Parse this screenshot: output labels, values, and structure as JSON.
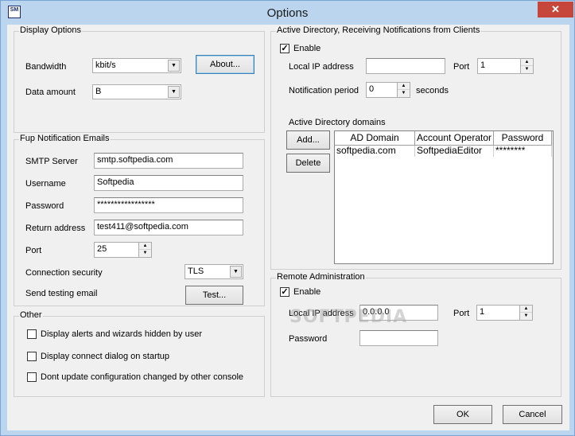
{
  "window": {
    "title": "Options",
    "icon": "app-icon",
    "icon_text": "SM",
    "close_glyph": "✕"
  },
  "display_options": {
    "title": "Display Options",
    "bandwidth_label": "Bandwidth",
    "bandwidth_value": "kbit/s",
    "data_amount_label": "Data amount",
    "data_amount_value": "B",
    "about_button": "About..."
  },
  "fup": {
    "title": "Fup Notification Emails",
    "smtp_label": "SMTP Server",
    "smtp_value": "smtp.softpedia.com",
    "username_label": "Username",
    "username_value": "Softpedia",
    "password_label": "Password",
    "password_value": "*****************",
    "return_label": "Return address",
    "return_value": "test411@softpedia.com",
    "port_label": "Port",
    "port_value": "25",
    "security_label": "Connection security",
    "security_value": "TLS",
    "test_label": "Send testing email",
    "test_button": "Test..."
  },
  "other": {
    "title": "Other",
    "options": [
      {
        "label": "Display alerts and wizards hidden by user",
        "checked": false
      },
      {
        "label": "Display connect dialog on startup",
        "checked": false
      },
      {
        "label": "Dont update configuration changed by other console",
        "checked": false
      }
    ]
  },
  "active_directory": {
    "title": "Active Directory, Receiving Notifications from Clients",
    "enable_label": "Enable",
    "enable_checked": true,
    "local_ip_label": "Local IP address",
    "local_ip_value": "",
    "port_label": "Port",
    "port_value": "1",
    "period_label": "Notification period",
    "period_value": "0",
    "period_unit": "seconds",
    "domains_label": "Active Directory domains",
    "add_button": "Add...",
    "delete_button": "Delete",
    "columns": [
      "AD Domain",
      "Account Operator",
      "Password"
    ],
    "rows": [
      [
        "softpedia.com",
        "SoftpediaEditor",
        "********"
      ]
    ]
  },
  "remote": {
    "title": "Remote Administration",
    "enable_label": "Enable",
    "enable_checked": true,
    "local_ip_label": "Local IP address",
    "local_ip_value": "0.0.0.0",
    "port_label": "Port",
    "port_value": "1",
    "password_label": "Password",
    "password_value": ""
  },
  "footer": {
    "ok_button": "OK",
    "cancel_button": "Cancel"
  },
  "watermark": "SOFTPEDIA",
  "colors": {
    "title_bar": "#bcd5ef",
    "close_button": "#c7463b",
    "dialog_bg": "#f0f0f0"
  }
}
